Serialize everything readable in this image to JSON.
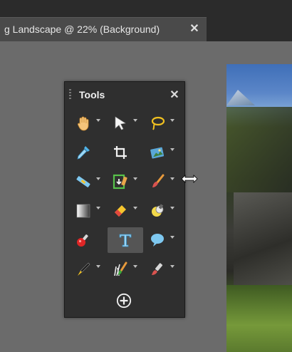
{
  "document_tab": {
    "title": "g Landscape @  22% (Background)",
    "close_label": "✕"
  },
  "tools_panel": {
    "title": "Tools",
    "close_label": "✕",
    "tools": [
      {
        "name": "hand",
        "has_flyout": true
      },
      {
        "name": "pointer",
        "has_flyout": true
      },
      {
        "name": "lasso",
        "has_flyout": true
      },
      {
        "name": "eyedropper",
        "has_flyout": false
      },
      {
        "name": "crop",
        "has_flyout": false
      },
      {
        "name": "image-adjust",
        "has_flyout": true
      },
      {
        "name": "straighten",
        "has_flyout": true
      },
      {
        "name": "smart-fill",
        "has_flyout": true
      },
      {
        "name": "paintbrush",
        "has_flyout": true
      },
      {
        "name": "gradient",
        "has_flyout": true
      },
      {
        "name": "eraser",
        "has_flyout": true
      },
      {
        "name": "dodge-burn",
        "has_flyout": true
      },
      {
        "name": "red-eye",
        "has_flyout": false
      },
      {
        "name": "text",
        "has_flyout": false,
        "selected": true
      },
      {
        "name": "speech-bubble",
        "has_flyout": true
      },
      {
        "name": "pen",
        "has_flyout": true
      },
      {
        "name": "grass-brush",
        "has_flyout": true
      },
      {
        "name": "clone",
        "has_flyout": true
      }
    ],
    "add_button_icon": "plus-circle-icon"
  },
  "colors": {
    "panel_bg": "#2f2f2f",
    "canvas_bg": "#6b6b6b",
    "selected_tool_bg": "#555555"
  }
}
